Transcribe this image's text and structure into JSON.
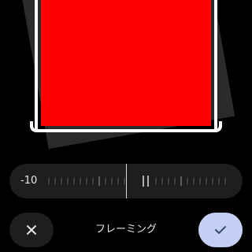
{
  "editor": {
    "straighten_value": "-10",
    "mode_label": "フレーミング"
  },
  "buttons": {
    "close_icon": "close-icon",
    "confirm_icon": "check-icon"
  },
  "colors": {
    "background": "#000000",
    "photo": "#ff0000",
    "frame": "#ffffff",
    "control_bg": "#1c1e20",
    "confirm_bg": "#c5d0f6",
    "text": "#e6e6e6"
  }
}
